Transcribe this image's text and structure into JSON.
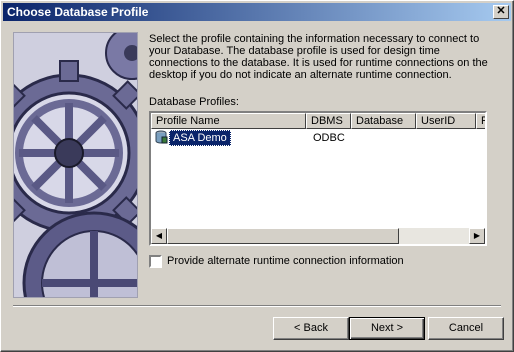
{
  "window": {
    "title": "Choose Database Profile",
    "close_glyph": "✕"
  },
  "description": "Select the profile containing the information necessary to connect to your Database. The database profile is used for design time connections to the database. It is used for runtime connections on the desktop if you do not indicate an alternate runtime connection.",
  "profiles_label": "Database Profiles:",
  "listview": {
    "columns": [
      "Profile Name",
      "DBMS",
      "Database",
      "UserID",
      "Pa"
    ],
    "rows": [
      {
        "profile_name": "ASA Demo",
        "dbms": "ODBC",
        "database": "",
        "userid": "",
        "selected": true
      }
    ]
  },
  "alternate_runtime": {
    "label": "Provide alternate runtime connection information",
    "checked": false
  },
  "buttons": {
    "back": "< Back",
    "next": "Next >",
    "cancel": "Cancel"
  },
  "colors": {
    "titlebar_start": "#0a246a",
    "titlebar_end": "#a6caf0",
    "selection": "#0a246a",
    "dialog_bg": "#d4d0c8"
  }
}
